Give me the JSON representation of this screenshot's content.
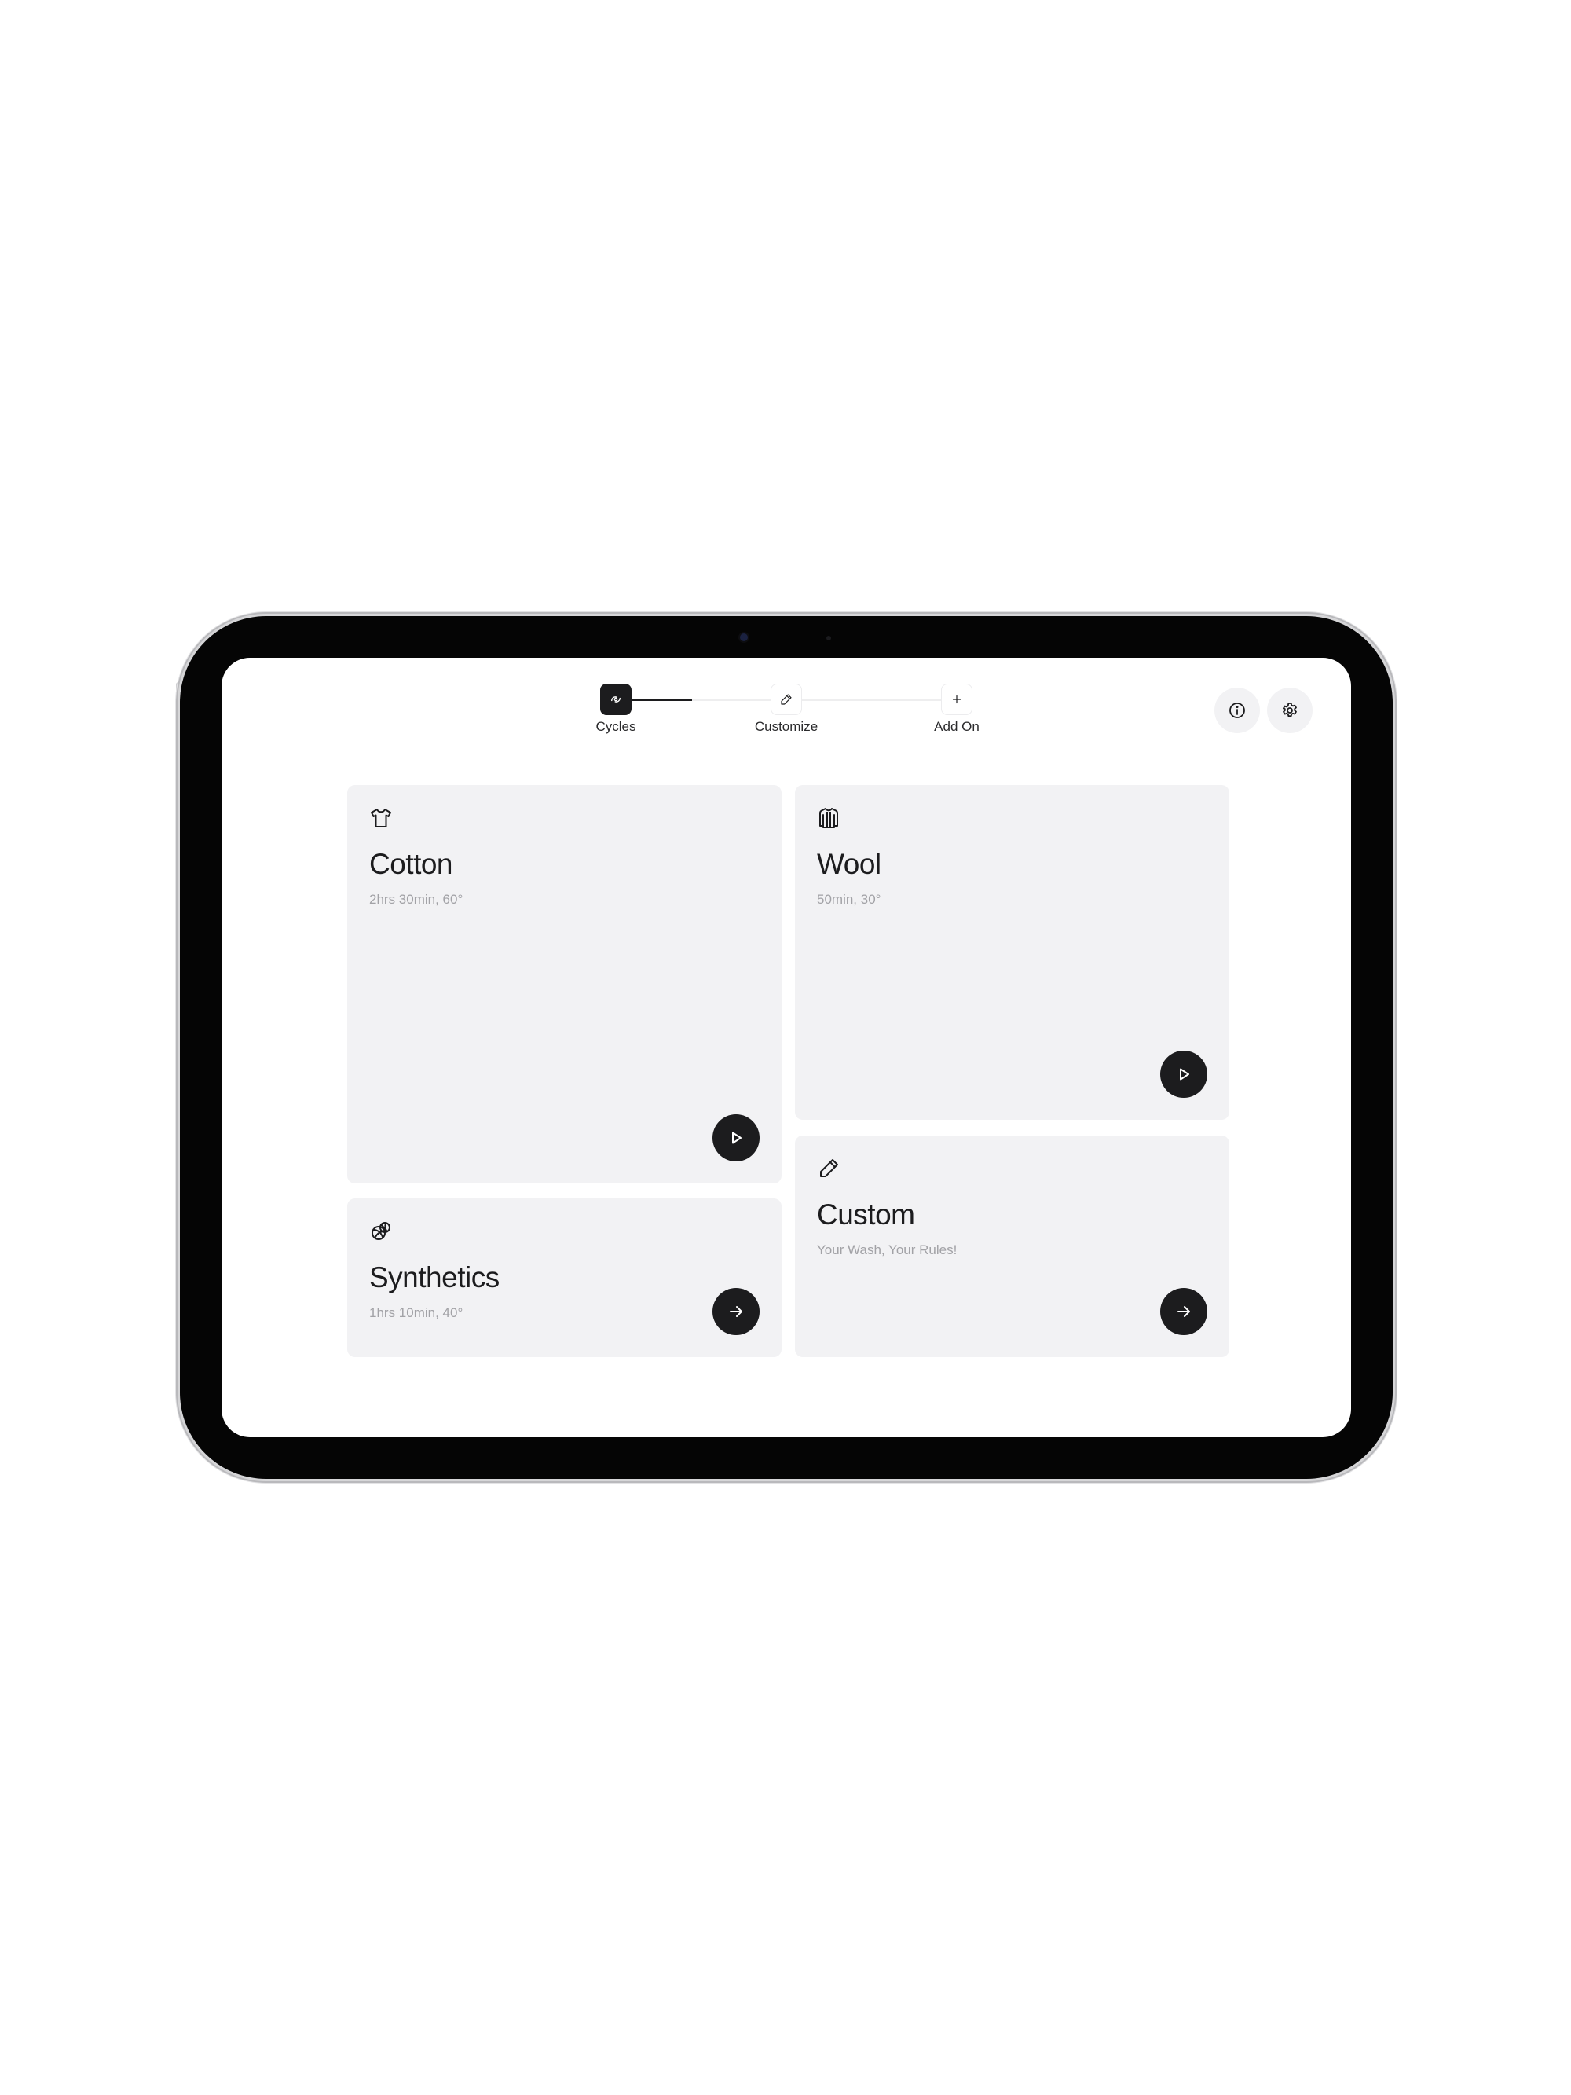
{
  "stepper": {
    "steps": [
      {
        "label": "Cycles",
        "icon": "cycles-icon",
        "active": true
      },
      {
        "label": "Customize",
        "icon": "pencil-icon",
        "active": false
      },
      {
        "label": "Add On",
        "icon": "plus-icon",
        "active": false
      }
    ],
    "progress": 0.25
  },
  "header": {
    "info_icon": "info-icon",
    "settings_icon": "gear-icon"
  },
  "cards": {
    "cotton": {
      "title": "Cotton",
      "subtitle": "2hrs 30min, 60°",
      "icon": "tshirt-icon",
      "action_icon": "play-icon"
    },
    "wool": {
      "title": "Wool",
      "subtitle": "50min, 30°",
      "icon": "sweater-icon",
      "action_icon": "play-icon"
    },
    "synthetics": {
      "title": "Synthetics",
      "subtitle": "1hrs 10min, 40°",
      "icon": "yarn-icon",
      "action_icon": "arrow-right-icon"
    },
    "custom": {
      "title": "Custom",
      "subtitle": "Your Wash, Your Rules!",
      "icon": "pencil-icon",
      "action_icon": "arrow-right-icon"
    }
  },
  "colors": {
    "card_background": "#f2f2f4",
    "accent_dark": "#1c1c1e",
    "subtitle_text": "#a2a2a6",
    "device_bezel": "#050505"
  }
}
